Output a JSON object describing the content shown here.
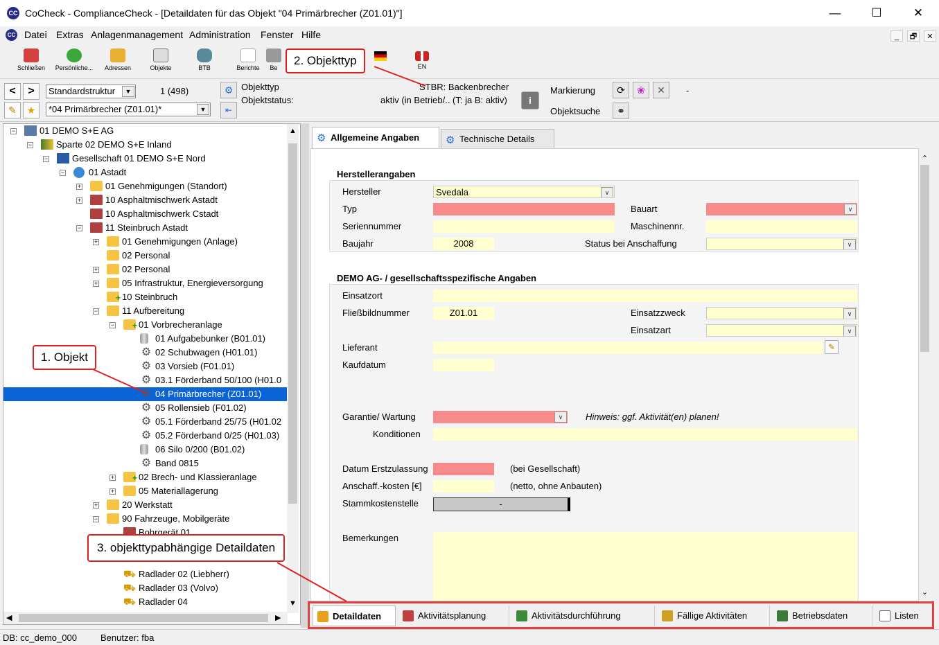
{
  "window": {
    "title": "CoCheck - ComplianceCheck - [Detaildaten für das Objekt \"04 Primärbrecher (Z01.01)\"]",
    "app_icon": "CC",
    "minimize": "—",
    "maximize": "☐",
    "close": "✕"
  },
  "menubar": {
    "items": [
      "Datei",
      "Extras",
      "Anlagenmanagement",
      "Administration",
      "Fenster",
      "Hilfe"
    ],
    "mdi_min": "_",
    "mdi_restore": "🗗",
    "mdi_close": "✕"
  },
  "toolbar": {
    "buttons": [
      {
        "label": "Schließen",
        "icon": "close-window-icon",
        "color": "#d44040"
      },
      {
        "label": "Persönliche...",
        "icon": "exclamation-icon",
        "color": "#3aa83a"
      },
      {
        "label": "Adressen",
        "icon": "address-book-icon",
        "color": "#e8b030"
      },
      {
        "label": "Objekte",
        "icon": "objects-icon",
        "color": "#777777"
      },
      {
        "label": "BTB",
        "icon": "database-icon",
        "color": "#5a8a9a"
      },
      {
        "label": "Berichte",
        "icon": "report-icon",
        "color": "#aaaaaa"
      },
      {
        "label": "Be",
        "icon": "edit-icon",
        "color": "#999999"
      }
    ],
    "lang_de": "",
    "lang_en": "EN"
  },
  "nav": {
    "back": "<",
    "forward": ">",
    "structure": "Standardstruktur",
    "counter": "1 (498)",
    "object_combo": "*04 Primärbrecher (Z01.01)*",
    "objekttyp_label": "Objekttyp",
    "objekttyp_value": "STBR: Backenbrecher",
    "objektstatus_label": "Objektstatus:",
    "objektstatus_value": "aktiv (in Betrieb/.. (T: ja B: aktiv)",
    "markierung_label": "Markierung",
    "markierung_value": "-",
    "objektsuche_label": "Objektsuche"
  },
  "tree": {
    "nodes": [
      {
        "label": "01 DEMO S+E AG",
        "level": 0,
        "icon": "building",
        "exp": "−"
      },
      {
        "label": "Sparte 02 DEMO S+E Inland",
        "level": 1,
        "icon": "books",
        "exp": "−"
      },
      {
        "label": "Gesellschaft 01 DEMO S+E Nord",
        "level": 2,
        "icon": "book",
        "exp": "−"
      },
      {
        "label": "01 Astadt",
        "level": 3,
        "icon": "globe",
        "exp": "−"
      },
      {
        "label": "01 Genehmigungen (Standort)",
        "level": 4,
        "icon": "folder",
        "exp": "+"
      },
      {
        "label": "10 Asphaltmischwerk Astadt",
        "level": 4,
        "icon": "factory",
        "exp": "+"
      },
      {
        "label": "10 Asphaltmischwerk Cstadt",
        "level": 4,
        "icon": "factory",
        "exp": ""
      },
      {
        "label": "11 Steinbruch Astadt",
        "level": 4,
        "icon": "factory",
        "exp": "−"
      },
      {
        "label": "01 Genehmigungen (Anlage)",
        "level": 5,
        "icon": "folder",
        "exp": "+"
      },
      {
        "label": "02 Personal",
        "level": 5,
        "icon": "folder",
        "exp": ""
      },
      {
        "label": "02 Personal",
        "level": 5,
        "icon": "folder",
        "exp": "+"
      },
      {
        "label": "05 Infrastruktur, Energieversorgung",
        "level": 5,
        "icon": "folder",
        "exp": "+"
      },
      {
        "label": "10 Steinbruch",
        "level": 5,
        "icon": "folderplus",
        "exp": ""
      },
      {
        "label": "11 Aufbereitung",
        "level": 5,
        "icon": "folder",
        "exp": "−"
      },
      {
        "label": "01 Vorbrecheranlage",
        "level": 6,
        "icon": "folderplus",
        "exp": "−"
      },
      {
        "label": "01 Aufgabebunker (B01.01)",
        "level": 7,
        "icon": "silo",
        "exp": ""
      },
      {
        "label": "02 Schubwagen (H01.01)",
        "level": 7,
        "icon": "gear",
        "exp": ""
      },
      {
        "label": "03 Vorsieb (F01.01)",
        "level": 7,
        "icon": "gear",
        "exp": ""
      },
      {
        "label": "03.1 Förderband 50/100 (H01.0",
        "level": 7,
        "icon": "gear",
        "exp": ""
      },
      {
        "label": "04 Primärbrecher (Z01.01)",
        "level": 7,
        "icon": "gear",
        "exp": "",
        "selected": true
      },
      {
        "label": "05 Rollensieb (F01.02)",
        "level": 7,
        "icon": "gear",
        "exp": ""
      },
      {
        "label": "05.1 Förderband 25/75 (H01.02",
        "level": 7,
        "icon": "gear",
        "exp": ""
      },
      {
        "label": "05.2 Förderband 0/25 (H01.03)",
        "level": 7,
        "icon": "gear",
        "exp": ""
      },
      {
        "label": "06 Silo 0/200 (B01.02)",
        "level": 7,
        "icon": "silo",
        "exp": ""
      },
      {
        "label": "Band 0815",
        "level": 7,
        "icon": "gear",
        "exp": ""
      },
      {
        "label": "02 Brech- und Klassieranlage",
        "level": 6,
        "icon": "folderplus",
        "exp": "+"
      },
      {
        "label": "05 Materiallagerung",
        "level": 6,
        "icon": "folder",
        "exp": "+"
      },
      {
        "label": "20 Werkstatt",
        "level": 5,
        "icon": "folder",
        "exp": "+"
      },
      {
        "label": "90 Fahrzeuge, Mobilgeräte",
        "level": 5,
        "icon": "folder",
        "exp": "−"
      },
      {
        "label": "Bohrgerät 01",
        "level": 6,
        "icon": "factory",
        "exp": ""
      },
      {
        "label": "",
        "level": 6,
        "icon": "",
        "exp": ""
      },
      {
        "label": "",
        "level": 6,
        "icon": "",
        "exp": ""
      },
      {
        "label": "Radlader 02 (Liebherr)",
        "level": 6,
        "icon": "loader",
        "exp": ""
      },
      {
        "label": "Radlader 03 (Volvo)",
        "level": 6,
        "icon": "loader",
        "exp": ""
      },
      {
        "label": "Radlader 04",
        "level": 6,
        "icon": "loader",
        "exp": ""
      }
    ]
  },
  "tabs": {
    "allgemein": "Allgemeine Angaben",
    "technisch": "Technische Details"
  },
  "form": {
    "hersteller_section": "Herstellerangaben",
    "hersteller_label": "Hersteller",
    "hersteller_value": "Svedala",
    "typ_label": "Typ",
    "bauart_label": "Bauart",
    "seriennummer_label": "Seriennummer",
    "maschinennr_label": "Maschinennr.",
    "baujahr_label": "Baujahr",
    "baujahr_value": "2008",
    "status_anschaffung_label": "Status bei Anschaffung",
    "demo_section": "DEMO AG- / gesellschaftsspezifische Angaben",
    "einsatzort_label": "Einsatzort",
    "fliessbild_label": "Fließbildnummer",
    "fliessbild_value": "Z01.01",
    "einsatzzweck_label": "Einsatzzweck",
    "einsatzart_label": "Einsatzart",
    "lieferant_label": "Lieferant",
    "kaufdatum_label": "Kaufdatum",
    "garantie_label": "Garantie/ Wartung",
    "hinweis": "Hinweis: ggf. Aktivität(en) planen!",
    "konditionen_label": "Konditionen",
    "erstzulassung_label": "Datum Erstzulassung",
    "erstzulassung_note": "(bei Gesellschaft)",
    "anschaff_label": "Anschaff.-kosten [€]",
    "anschaff_note": "(netto, ohne Anbauten)",
    "stammkosten_label": "Stammkostenstelle",
    "stammkosten_value": "-",
    "bemerkungen_label": "Bemerkungen"
  },
  "bottom_tabs": [
    {
      "label": "Detaildaten",
      "color": "#e8a020"
    },
    {
      "label": "Aktivitätsplanung",
      "color": "#c04040"
    },
    {
      "label": "Aktivitätsdurchführung",
      "color": "#3a8a3a"
    },
    {
      "label": "Fällige Aktivitäten",
      "color": "#d0a020"
    },
    {
      "label": "Betriebsdaten",
      "color": "#3a7a3a"
    },
    {
      "label": "Listen",
      "color": "#666666"
    }
  ],
  "statusbar": {
    "db": "DB: cc_demo_000",
    "user": "Benutzer: fba"
  },
  "callouts": {
    "objekt": "1. Objekt",
    "objekttyp": "2. Objekttyp",
    "detaildaten": "3. objekttypabhängige Detaildaten"
  },
  "colors": {
    "required_field": "#f78a8a",
    "optional_field": "#ffffd0",
    "selection": "#0a64d8",
    "callout_border": "#e02020"
  }
}
